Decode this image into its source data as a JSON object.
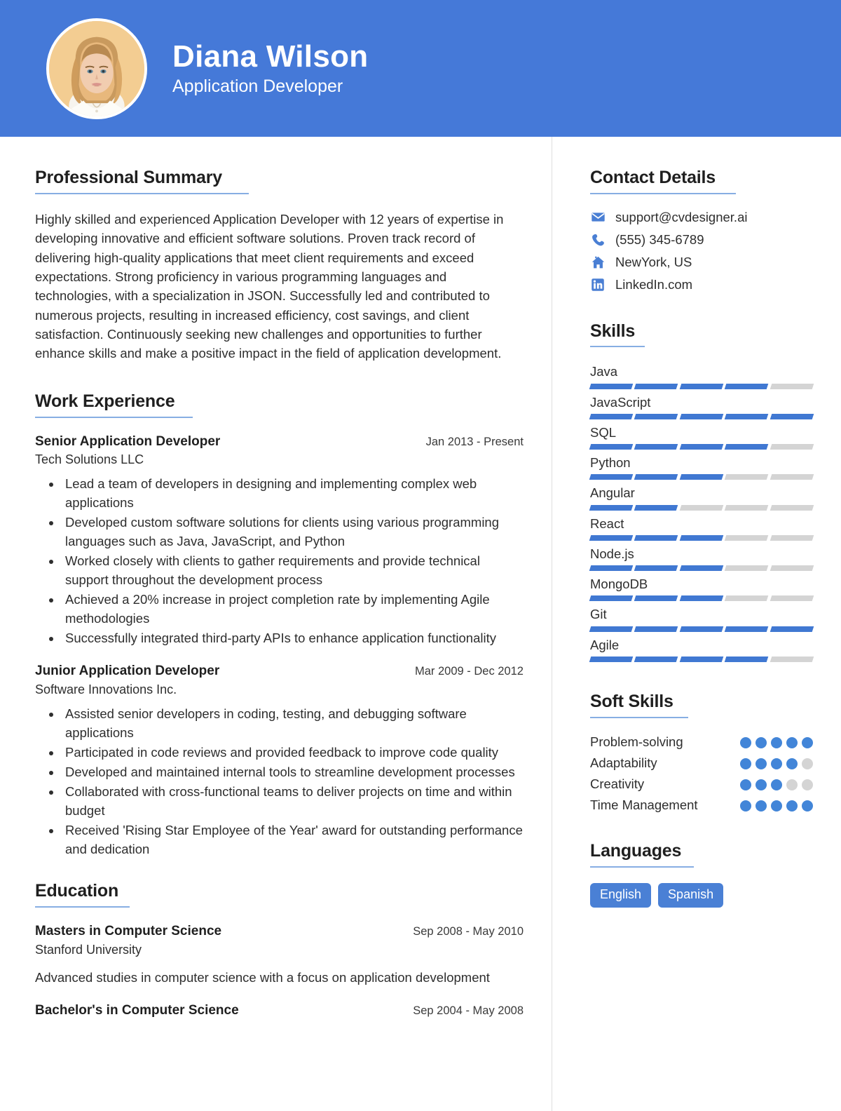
{
  "colors": {
    "header_bg": "#4579d8",
    "accent": "#4078d2",
    "rule": "#87aee3",
    "muted_bar": "#d4d4d4",
    "tag_bg": "#4a80d5",
    "avatar_bg": "#f3cd92"
  },
  "header": {
    "name": "Diana Wilson",
    "job_title": "Application Developer",
    "avatar_alt": "profile-photo"
  },
  "main": {
    "summary_section": {
      "title": "Professional Summary",
      "text": "Highly skilled and experienced Application Developer with 12 years of expertise in developing innovative and efficient software solutions. Proven track record of delivering high-quality applications that meet client requirements and exceed expectations. Strong proficiency in various programming languages and technologies, with a specialization in JSON. Successfully led and contributed to numerous projects, resulting in increased efficiency, cost savings, and client satisfaction. Continuously seeking new challenges and opportunities to further enhance skills and make a positive impact in the field of application development."
    },
    "work_section": {
      "title": "Work Experience",
      "entries": [
        {
          "role": "Senior Application Developer",
          "date": "Jan 2013 - Present",
          "org": "Tech Solutions LLC",
          "bullets": [
            "Lead a team of developers in designing and implementing complex web applications",
            "Developed custom software solutions for clients using various programming languages such as Java, JavaScript, and Python",
            "Worked closely with clients to gather requirements and provide technical support throughout the development process",
            "Achieved a 20% increase in project completion rate by implementing Agile methodologies",
            "Successfully integrated third-party APIs to enhance application functionality"
          ]
        },
        {
          "role": "Junior Application Developer",
          "date": "Mar 2009 - Dec 2012",
          "org": "Software Innovations Inc.",
          "bullets": [
            "Assisted senior developers in coding, testing, and debugging software applications",
            "Participated in code reviews and provided feedback to improve code quality",
            "Developed and maintained internal tools to streamline development processes",
            "Collaborated with cross-functional teams to deliver projects on time and within budget",
            "Received 'Rising Star Employee of the Year' award for outstanding performance and dedication"
          ]
        }
      ]
    },
    "education_section": {
      "title": "Education",
      "entries": [
        {
          "degree": "Masters in Computer Science",
          "date": "Sep 2008 - May 2010",
          "school": "Stanford University",
          "description": "Advanced studies in computer science with a focus on application development"
        },
        {
          "degree": "Bachelor's in Computer Science",
          "date": "Sep 2004 - May 2008",
          "school": "",
          "description": ""
        }
      ]
    }
  },
  "sidebar": {
    "contact_section": {
      "title": "Contact Details",
      "items": [
        {
          "icon": "envelope-icon",
          "value": "support@cvdesigner.ai"
        },
        {
          "icon": "phone-icon",
          "value": "(555) 345-6789"
        },
        {
          "icon": "home-icon",
          "value": "NewYork, US"
        },
        {
          "icon": "linkedin-icon",
          "value": "LinkedIn.com"
        }
      ]
    },
    "skills_section": {
      "title": "Skills",
      "max_level": 5,
      "items": [
        {
          "name": "Java",
          "level": 4
        },
        {
          "name": "JavaScript",
          "level": 5
        },
        {
          "name": "SQL",
          "level": 4
        },
        {
          "name": "Python",
          "level": 3
        },
        {
          "name": "Angular",
          "level": 2
        },
        {
          "name": "React",
          "level": 3
        },
        {
          "name": "Node.js",
          "level": 3
        },
        {
          "name": "MongoDB",
          "level": 3
        },
        {
          "name": "Git",
          "level": 5
        },
        {
          "name": "Agile",
          "level": 4
        }
      ]
    },
    "soft_skills_section": {
      "title": "Soft Skills",
      "max_level": 5,
      "items": [
        {
          "name": "Problem-solving",
          "level": 5
        },
        {
          "name": "Adaptability",
          "level": 4
        },
        {
          "name": "Creativity",
          "level": 3
        },
        {
          "name": "Time Management",
          "level": 5
        }
      ]
    },
    "languages_section": {
      "title": "Languages",
      "items": [
        "English",
        "Spanish"
      ]
    }
  }
}
